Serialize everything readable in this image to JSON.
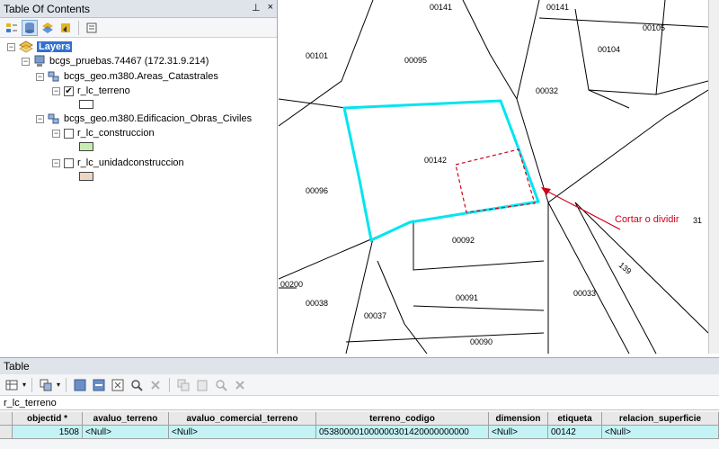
{
  "toc": {
    "title": "Table Of Contents",
    "pin_glyph": "⊥",
    "close_glyph": "×",
    "root_label": "Layers",
    "db1_label": "bcgs_pruebas.74467 (172.31.9.214)",
    "group1_label": "bcgs_geo.m380.Areas_Catastrales",
    "layer1_label": "r_lc_terreno",
    "group2_label": "bcgs_geo.m380.Edificacion_Obras_Civiles",
    "layer2_label": "r_lc_construccion",
    "layer3_label": "r_lc_unidadconstruccion",
    "colors": {
      "terreno": "#ffffff",
      "construccion": "#c8ecb0",
      "unidadconstruccion": "#ecd6c4"
    }
  },
  "map": {
    "labels": {
      "p00141a": "00141",
      "p00141b": "00141",
      "p00105": "00105",
      "p00104": "00104",
      "p00101": "00101",
      "p00095": "00095",
      "p00032": "00032",
      "p00142": "00142",
      "p00096": "00096",
      "p00092": "00092",
      "p00031": "31",
      "p139": "139",
      "p00200": "00200",
      "p00038": "00038",
      "p00091": "00091",
      "p00033": "00033",
      "p00037": "00037",
      "p00090": "00090"
    },
    "annotation": "Cortar o dividir",
    "selection_color": "#00e5ee",
    "annotation_color": "#d0021b"
  },
  "table": {
    "title": "Table",
    "layer_tab": "r_lc_terreno",
    "columns": [
      "objectid *",
      "avaluo_terreno",
      "avaluo_comercial_terreno",
      "terreno_codigo",
      "dimension",
      "etiqueta",
      "relacion_superficie"
    ],
    "rows": [
      [
        "1508",
        "<Null>",
        "<Null>",
        "053800001000000301420000000000",
        "<Null>",
        "00142",
        "<Null>"
      ]
    ]
  }
}
